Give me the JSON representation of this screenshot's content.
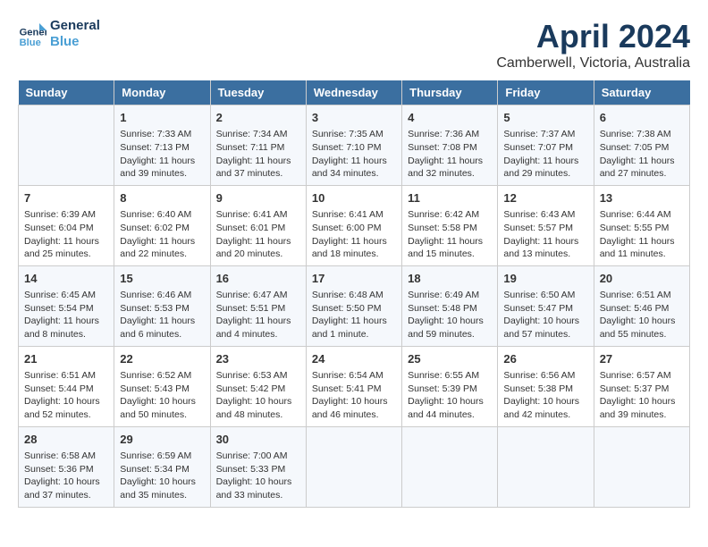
{
  "header": {
    "logo_line1": "General",
    "logo_line2": "Blue",
    "month": "April 2024",
    "location": "Camberwell, Victoria, Australia"
  },
  "weekdays": [
    "Sunday",
    "Monday",
    "Tuesday",
    "Wednesday",
    "Thursday",
    "Friday",
    "Saturday"
  ],
  "weeks": [
    [
      {
        "day": "",
        "sunrise": "",
        "sunset": "",
        "daylight": ""
      },
      {
        "day": "1",
        "sunrise": "Sunrise: 7:33 AM",
        "sunset": "Sunset: 7:13 PM",
        "daylight": "Daylight: 11 hours and 39 minutes."
      },
      {
        "day": "2",
        "sunrise": "Sunrise: 7:34 AM",
        "sunset": "Sunset: 7:11 PM",
        "daylight": "Daylight: 11 hours and 37 minutes."
      },
      {
        "day": "3",
        "sunrise": "Sunrise: 7:35 AM",
        "sunset": "Sunset: 7:10 PM",
        "daylight": "Daylight: 11 hours and 34 minutes."
      },
      {
        "day": "4",
        "sunrise": "Sunrise: 7:36 AM",
        "sunset": "Sunset: 7:08 PM",
        "daylight": "Daylight: 11 hours and 32 minutes."
      },
      {
        "day": "5",
        "sunrise": "Sunrise: 7:37 AM",
        "sunset": "Sunset: 7:07 PM",
        "daylight": "Daylight: 11 hours and 29 minutes."
      },
      {
        "day": "6",
        "sunrise": "Sunrise: 7:38 AM",
        "sunset": "Sunset: 7:05 PM",
        "daylight": "Daylight: 11 hours and 27 minutes."
      }
    ],
    [
      {
        "day": "7",
        "sunrise": "Sunrise: 6:39 AM",
        "sunset": "Sunset: 6:04 PM",
        "daylight": "Daylight: 11 hours and 25 minutes."
      },
      {
        "day": "8",
        "sunrise": "Sunrise: 6:40 AM",
        "sunset": "Sunset: 6:02 PM",
        "daylight": "Daylight: 11 hours and 22 minutes."
      },
      {
        "day": "9",
        "sunrise": "Sunrise: 6:41 AM",
        "sunset": "Sunset: 6:01 PM",
        "daylight": "Daylight: 11 hours and 20 minutes."
      },
      {
        "day": "10",
        "sunrise": "Sunrise: 6:41 AM",
        "sunset": "Sunset: 6:00 PM",
        "daylight": "Daylight: 11 hours and 18 minutes."
      },
      {
        "day": "11",
        "sunrise": "Sunrise: 6:42 AM",
        "sunset": "Sunset: 5:58 PM",
        "daylight": "Daylight: 11 hours and 15 minutes."
      },
      {
        "day": "12",
        "sunrise": "Sunrise: 6:43 AM",
        "sunset": "Sunset: 5:57 PM",
        "daylight": "Daylight: 11 hours and 13 minutes."
      },
      {
        "day": "13",
        "sunrise": "Sunrise: 6:44 AM",
        "sunset": "Sunset: 5:55 PM",
        "daylight": "Daylight: 11 hours and 11 minutes."
      }
    ],
    [
      {
        "day": "14",
        "sunrise": "Sunrise: 6:45 AM",
        "sunset": "Sunset: 5:54 PM",
        "daylight": "Daylight: 11 hours and 8 minutes."
      },
      {
        "day": "15",
        "sunrise": "Sunrise: 6:46 AM",
        "sunset": "Sunset: 5:53 PM",
        "daylight": "Daylight: 11 hours and 6 minutes."
      },
      {
        "day": "16",
        "sunrise": "Sunrise: 6:47 AM",
        "sunset": "Sunset: 5:51 PM",
        "daylight": "Daylight: 11 hours and 4 minutes."
      },
      {
        "day": "17",
        "sunrise": "Sunrise: 6:48 AM",
        "sunset": "Sunset: 5:50 PM",
        "daylight": "Daylight: 11 hours and 1 minute."
      },
      {
        "day": "18",
        "sunrise": "Sunrise: 6:49 AM",
        "sunset": "Sunset: 5:48 PM",
        "daylight": "Daylight: 10 hours and 59 minutes."
      },
      {
        "day": "19",
        "sunrise": "Sunrise: 6:50 AM",
        "sunset": "Sunset: 5:47 PM",
        "daylight": "Daylight: 10 hours and 57 minutes."
      },
      {
        "day": "20",
        "sunrise": "Sunrise: 6:51 AM",
        "sunset": "Sunset: 5:46 PM",
        "daylight": "Daylight: 10 hours and 55 minutes."
      }
    ],
    [
      {
        "day": "21",
        "sunrise": "Sunrise: 6:51 AM",
        "sunset": "Sunset: 5:44 PM",
        "daylight": "Daylight: 10 hours and 52 minutes."
      },
      {
        "day": "22",
        "sunrise": "Sunrise: 6:52 AM",
        "sunset": "Sunset: 5:43 PM",
        "daylight": "Daylight: 10 hours and 50 minutes."
      },
      {
        "day": "23",
        "sunrise": "Sunrise: 6:53 AM",
        "sunset": "Sunset: 5:42 PM",
        "daylight": "Daylight: 10 hours and 48 minutes."
      },
      {
        "day": "24",
        "sunrise": "Sunrise: 6:54 AM",
        "sunset": "Sunset: 5:41 PM",
        "daylight": "Daylight: 10 hours and 46 minutes."
      },
      {
        "day": "25",
        "sunrise": "Sunrise: 6:55 AM",
        "sunset": "Sunset: 5:39 PM",
        "daylight": "Daylight: 10 hours and 44 minutes."
      },
      {
        "day": "26",
        "sunrise": "Sunrise: 6:56 AM",
        "sunset": "Sunset: 5:38 PM",
        "daylight": "Daylight: 10 hours and 42 minutes."
      },
      {
        "day": "27",
        "sunrise": "Sunrise: 6:57 AM",
        "sunset": "Sunset: 5:37 PM",
        "daylight": "Daylight: 10 hours and 39 minutes."
      }
    ],
    [
      {
        "day": "28",
        "sunrise": "Sunrise: 6:58 AM",
        "sunset": "Sunset: 5:36 PM",
        "daylight": "Daylight: 10 hours and 37 minutes."
      },
      {
        "day": "29",
        "sunrise": "Sunrise: 6:59 AM",
        "sunset": "Sunset: 5:34 PM",
        "daylight": "Daylight: 10 hours and 35 minutes."
      },
      {
        "day": "30",
        "sunrise": "Sunrise: 7:00 AM",
        "sunset": "Sunset: 5:33 PM",
        "daylight": "Daylight: 10 hours and 33 minutes."
      },
      {
        "day": "",
        "sunrise": "",
        "sunset": "",
        "daylight": ""
      },
      {
        "day": "",
        "sunrise": "",
        "sunset": "",
        "daylight": ""
      },
      {
        "day": "",
        "sunrise": "",
        "sunset": "",
        "daylight": ""
      },
      {
        "day": "",
        "sunrise": "",
        "sunset": "",
        "daylight": ""
      }
    ]
  ]
}
